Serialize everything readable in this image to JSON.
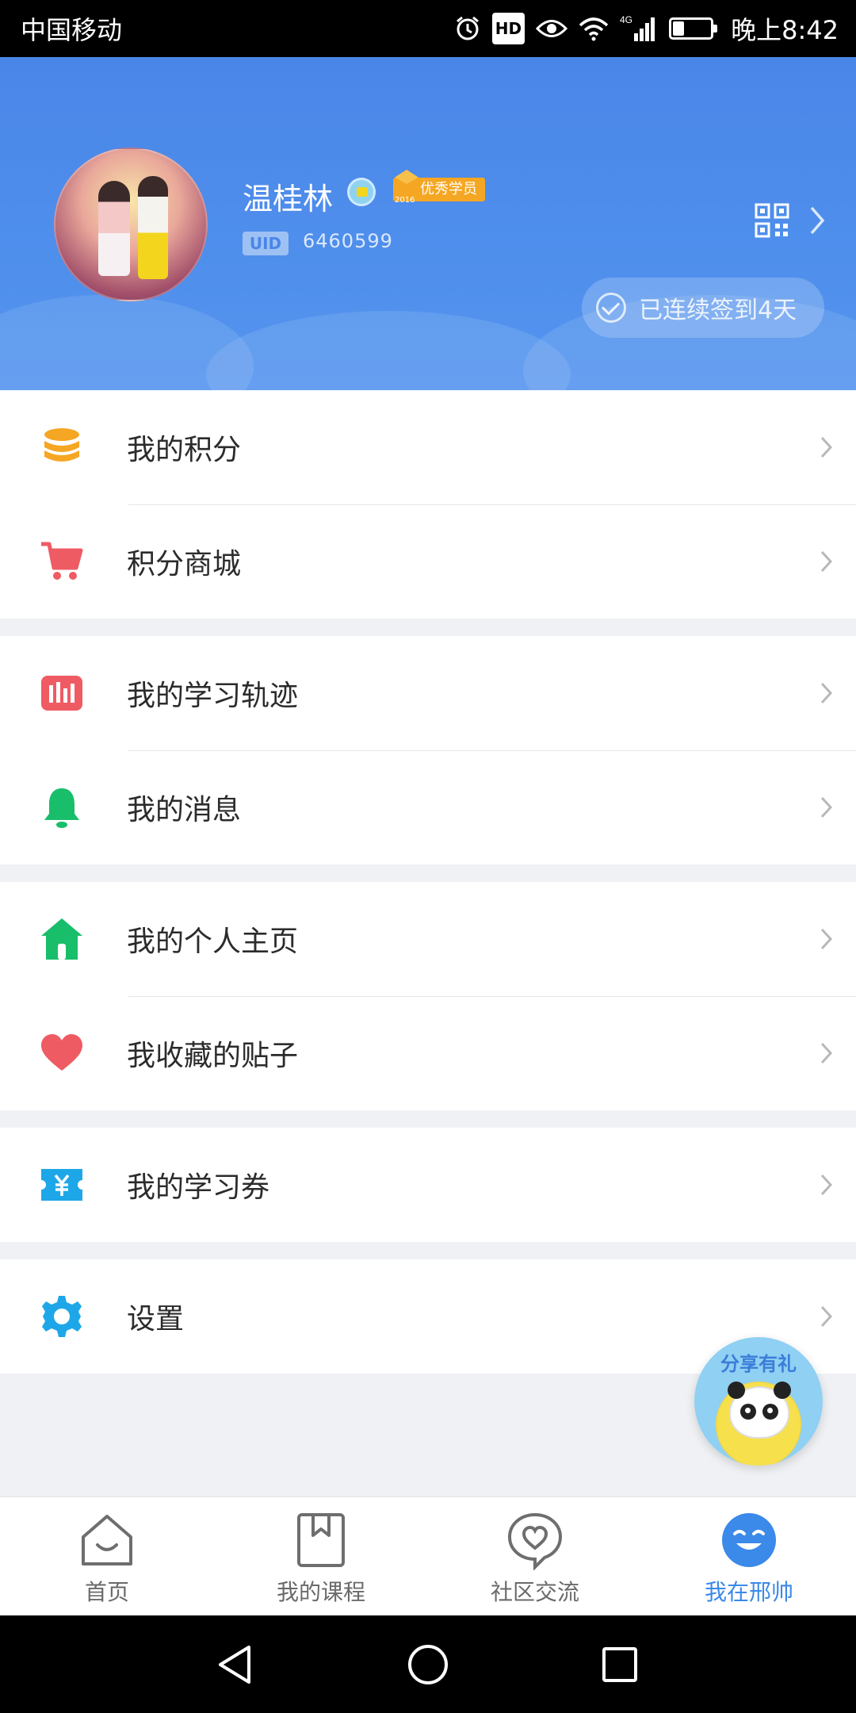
{
  "status_bar": {
    "carrier": "中国移动",
    "network": "4G",
    "hd": "HD",
    "time": "晚上8:42",
    "battery_level": 0.35
  },
  "profile": {
    "name": "温桂林",
    "badge": {
      "year": "2016",
      "label": "优秀学员"
    },
    "uid_label": "UID",
    "uid": "6460599",
    "checkin": "已连续签到4天"
  },
  "menu_groups": [
    [
      {
        "label": "我的积分",
        "icon": "coins-icon",
        "color": "#f5a623"
      },
      {
        "label": "积分商城",
        "icon": "cart-icon",
        "color": "#ef5b63"
      }
    ],
    [
      {
        "label": "我的学习轨迹",
        "icon": "chart-icon",
        "color": "#ef5b63"
      },
      {
        "label": "我的消息",
        "icon": "bell-icon",
        "color": "#19be6b"
      }
    ],
    [
      {
        "label": "我的个人主页",
        "icon": "home-icon",
        "color": "#19be6b"
      },
      {
        "label": "我收藏的贴子",
        "icon": "heart-icon",
        "color": "#ef5b63"
      }
    ],
    [
      {
        "label": "我的学习券",
        "icon": "ticket-icon",
        "color": "#1ea7e8"
      }
    ],
    [
      {
        "label": "设置",
        "icon": "gear-icon",
        "color": "#1ea7e8"
      }
    ]
  ],
  "share_fab": {
    "label": "分享有礼"
  },
  "tabs": [
    {
      "label": "首页",
      "icon": "house-smile-icon",
      "active": false
    },
    {
      "label": "我的课程",
      "icon": "bookmark-book-icon",
      "active": false
    },
    {
      "label": "社区交流",
      "icon": "heart-bubble-icon",
      "active": false
    },
    {
      "label": "我在邢帅",
      "icon": "smile-face-icon",
      "active": true
    }
  ],
  "colors": {
    "header_blue": "#4a86e8",
    "active_tab": "#3b89e8"
  }
}
